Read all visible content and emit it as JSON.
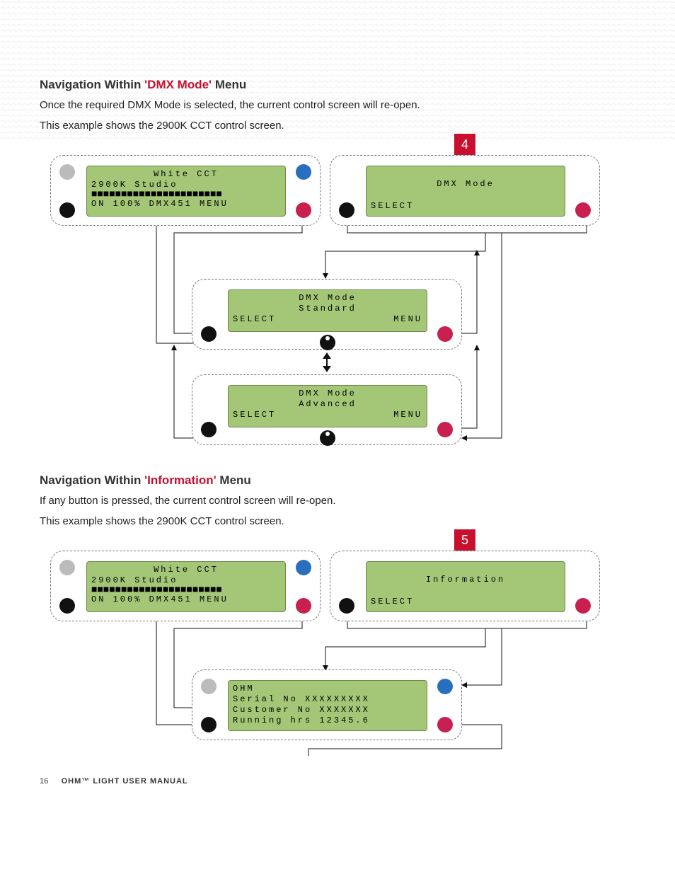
{
  "section1": {
    "heading_prefix": "Navigation Within ",
    "heading_red": "'DMX Mode'",
    "heading_suffix": " Menu",
    "body1": "Once the required DMX Mode is selected, the current control screen will re-open.",
    "body2": "This example shows the 2900K CCT control screen.",
    "badge": "4",
    "lcd_main": {
      "l1": "White  CCT",
      "l2": "2900K Studio",
      "l3": "■■■■■■■■■■■■■■■■■■■■■■",
      "l4": "ON  100% DMX451  MENU"
    },
    "lcd_dmx": {
      "title": "DMX Mode",
      "select": "SELECT"
    },
    "lcd_std": {
      "l1": "DMX Mode",
      "l2": "Standard",
      "l3a": "SELECT",
      "l3b": "MENU"
    },
    "lcd_adv": {
      "l1": "DMX Mode",
      "l2": "Advanced",
      "l3a": "SELECT",
      "l3b": "MENU"
    }
  },
  "section2": {
    "heading_prefix": "Navigation Within ",
    "heading_red": "'Information'",
    "heading_suffix": " Menu",
    "body1": "If any button is pressed, the current control screen will re-open.",
    "body2": "This example shows the 2900K CCT control screen.",
    "badge": "5",
    "lcd_main": {
      "l1": "White  CCT",
      "l2": "2900K Studio",
      "l3": "■■■■■■■■■■■■■■■■■■■■■■",
      "l4": "ON  100% DMX451  MENU"
    },
    "lcd_info": {
      "title": "Information",
      "select": "SELECT"
    },
    "lcd_detail": {
      "l1": "OHM",
      "l2": "Serial No XXXXXXXXX",
      "l3": "Customer No XXXXXXX",
      "l4": "Running hrs 12345.6"
    }
  },
  "footer": {
    "page": "16",
    "title": "OHM™ LIGHT USER MANUAL"
  }
}
